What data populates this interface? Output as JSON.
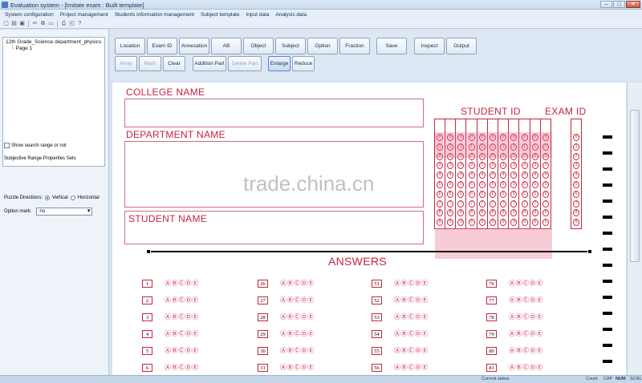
{
  "window": {
    "title": "Evaluation system - [Imitate exam : Built template]",
    "controls": {
      "minimize": "–",
      "maximize": "□",
      "close": "✕"
    }
  },
  "menu": [
    "System configuration",
    "Project management",
    "Students information management",
    "Subject template",
    "Input data",
    "Analysis data"
  ],
  "toolbar_icons": [
    "new-icon",
    "open-icon",
    "save-icon",
    "cut-icon",
    "copy-icon",
    "paste-icon",
    "print-icon",
    "preview-icon",
    "help-icon"
  ],
  "tree": {
    "root": "12th Grade_Science department_physics",
    "child": "Page 1"
  },
  "left": {
    "search_checkbox_label": "Show search range or not",
    "prop_label": "Subjective Range Properties Sets",
    "direction_label": "Puzzle Directions:",
    "direction_vertical": "Vertical",
    "direction_horizontal": "Horizontal",
    "option_label": "Option mark:",
    "option_value": "no"
  },
  "buttons_row1": [
    "Location",
    "Exam ID",
    "Annexation",
    "AB",
    "Object",
    "Subject",
    "Option",
    "Fraction",
    "Save",
    "Inspect",
    "Output"
  ],
  "buttons_row2": [
    "Array",
    "Mark",
    "Clear",
    "Addition Part",
    "Delete Part",
    "Enlarge",
    "Reduce"
  ],
  "sheet": {
    "college_label": "COLLEGE NAME",
    "department_label": "DEPARTMENT NAME",
    "student_label": "STUDENT NAME",
    "student_id_label": "STUDENT  ID",
    "exam_id_label": "EXAM  ID",
    "answers_label": "ANSWERS",
    "answer_numbers": [
      [
        "1",
        "2",
        "3",
        "4",
        "5",
        "6"
      ],
      [
        "26",
        "27",
        "28",
        "29",
        "30",
        "31"
      ],
      [
        "51",
        "52",
        "53",
        "54",
        "55",
        "56"
      ],
      [
        "76",
        "77",
        "78",
        "79",
        "80",
        "81"
      ]
    ],
    "bubble_string": "ⒶⒷⒸⒹⒺ",
    "digits": [
      "0",
      "1",
      "2",
      "3",
      "4",
      "5",
      "6",
      "7",
      "8",
      "9"
    ]
  },
  "watermark": "trade.china.cn",
  "status": {
    "current_status": "Current status",
    "count": "Count",
    "cap": "CAP",
    "num": "NUM",
    "scrl": "SCRL"
  },
  "colors": {
    "accent_red": "#c7233f",
    "window_blue": "#d7e4f2"
  }
}
